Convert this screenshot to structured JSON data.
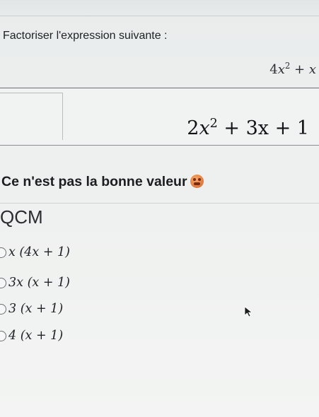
{
  "question": {
    "prompt": "Factoriser l'expression suivante :",
    "expression": {
      "coef": "4",
      "var1": "x",
      "exp": "2",
      "op": " + ",
      "var2": "x"
    }
  },
  "answer": {
    "coef": "2",
    "var": "x",
    "exp": "2",
    "rest": " + 3x + 1"
  },
  "feedback": {
    "text": "Ce n'est pas la bonne valeur",
    "icon": "sad-face-emoji"
  },
  "qcm": {
    "title": "QCM",
    "options": [
      {
        "label": "x (4x + 1)"
      },
      {
        "label": "3x (x + 1)"
      },
      {
        "label": "3 (x + 1)"
      },
      {
        "label": "4 (x + 1)"
      }
    ]
  },
  "colors": {
    "feedback_emoji": "#e0783c"
  }
}
